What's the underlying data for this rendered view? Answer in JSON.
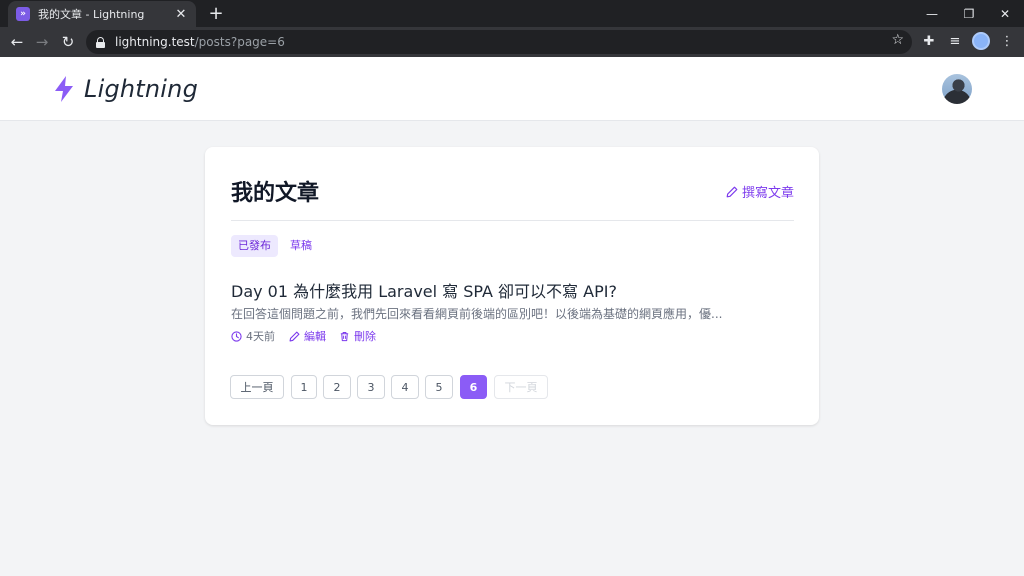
{
  "browser": {
    "tab_title": "我的文章 - Lightning",
    "favicon_text": "»",
    "url_host": "lightning.test",
    "url_path": "/posts?page=6",
    "icons": {
      "back": "arrow-left-icon",
      "forward": "arrow-right-icon",
      "reload": "reload-icon",
      "bookmark": "star-icon",
      "extensions": "puzzle-icon",
      "media": "media-queue-icon",
      "menu": "kebab-menu-icon"
    }
  },
  "site": {
    "name": "Lightning",
    "accent_color": "#8b5cf6"
  },
  "main": {
    "title": "我的文章",
    "write_label": "撰寫文章",
    "tabs": [
      {
        "label": "已發布",
        "active": true
      },
      {
        "label": "草稿",
        "active": false
      }
    ],
    "posts": [
      {
        "title": "Day 01 為什麼我用 Laravel 寫 SPA 卻可以不寫 API?",
        "excerpt": "在回答這個問題之前，我們先回來看看網頁前後端的區別吧！以後端為基礎的網頁應用，優...",
        "time": "4天前",
        "edit_label": "編輯",
        "delete_label": "刪除"
      }
    ],
    "pagination": {
      "prev_label": "上一頁",
      "next_label": "下一頁",
      "pages": [
        "1",
        "2",
        "3",
        "4",
        "5",
        "6"
      ],
      "current": 6
    }
  }
}
